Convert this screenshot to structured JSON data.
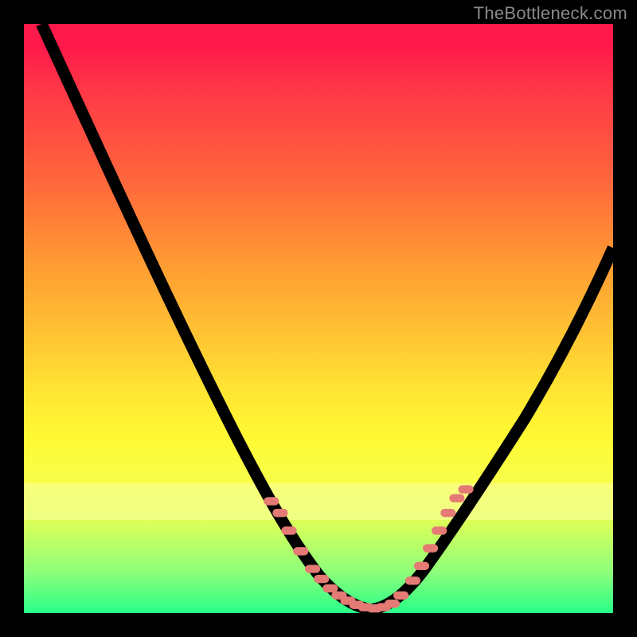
{
  "watermark": "TheBottleneck.com",
  "chart_data": {
    "type": "line",
    "title": "",
    "xlabel": "",
    "ylabel": "",
    "xlim": [
      0,
      100
    ],
    "ylim": [
      0,
      100
    ],
    "grid": false,
    "legend": false,
    "background_gradient": {
      "top": "#ff1a4b",
      "mid": "#fff933",
      "bottom": "#27ff88"
    },
    "series": [
      {
        "name": "bottleneck-curve-left",
        "x": [
          3,
          8,
          14,
          20,
          26,
          32,
          38,
          43,
          47,
          50,
          53,
          56,
          59
        ],
        "values": [
          100,
          88,
          76,
          64,
          52,
          40,
          28,
          18,
          10,
          6,
          3,
          1.2,
          0.5
        ]
      },
      {
        "name": "bottleneck-curve-right",
        "x": [
          59,
          62,
          65,
          68,
          71,
          75,
          80,
          86,
          92,
          100
        ],
        "values": [
          0.5,
          1.5,
          4,
          8,
          13,
          20,
          29,
          40,
          50,
          62
        ]
      }
    ],
    "markers": {
      "name": "optimum-band-dots",
      "style": "pill",
      "color": "#e47a74",
      "x": [
        42,
        43.5,
        45,
        47,
        49,
        50.5,
        52,
        53.5,
        55,
        56.5,
        58,
        59.5,
        61,
        62.5,
        64,
        66,
        67.5,
        69,
        70.5,
        72,
        73.5,
        75
      ],
      "y": [
        19,
        17,
        14,
        10.5,
        7.5,
        5.8,
        4.2,
        3,
        2.1,
        1.4,
        1,
        0.8,
        1,
        1.6,
        3,
        5.5,
        8,
        11,
        14,
        17,
        19.5,
        21
      ]
    }
  }
}
